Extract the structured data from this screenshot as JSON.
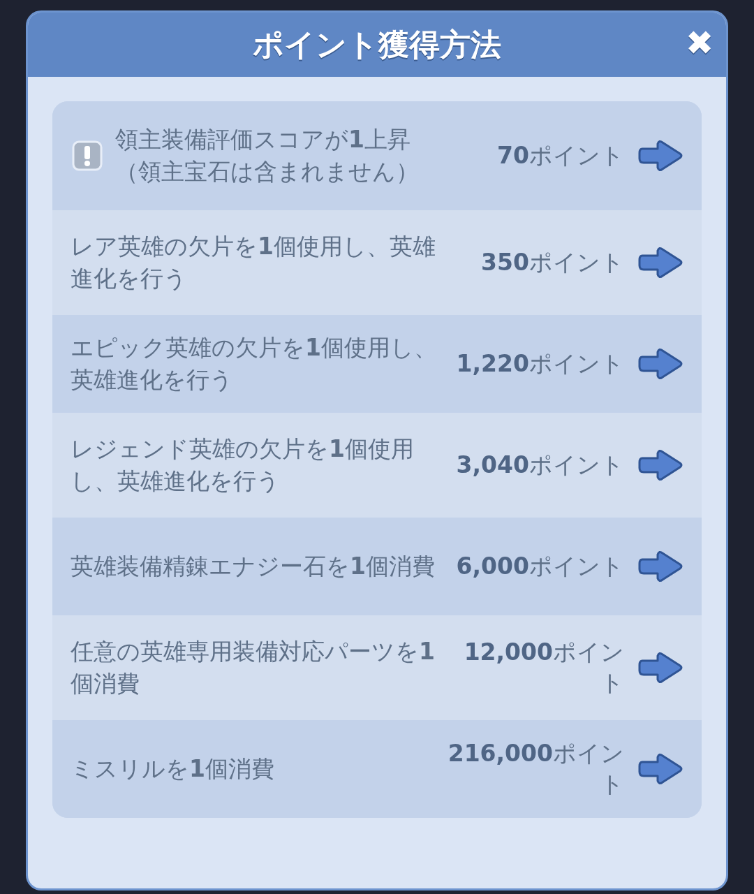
{
  "dialog": {
    "title": "ポイント獲得方法",
    "close_label": "✖"
  },
  "rows": [
    {
      "notice": true,
      "description": "領主装備評価スコアが**1**上昇（領主宝石は含まれません）",
      "points": "**70**ポイント"
    },
    {
      "notice": false,
      "description": "レア英雄の欠片を**1**個使用し、英雄進化を行う",
      "points": "**350**ポイント"
    },
    {
      "notice": false,
      "description": "エピック英雄の欠片を**1**個使用し、英雄進化を行う",
      "points": "**1,220**ポイント"
    },
    {
      "notice": false,
      "description": "レジェンド英雄の欠片を**1**個使用し、英雄進化を行う",
      "points": "**3,040**ポイント"
    },
    {
      "notice": false,
      "description": "英雄装備精錬エナジー石を**1**個消費",
      "points": "**6,000**ポイント"
    },
    {
      "notice": false,
      "description": "任意の英雄専用装備対応パーツを**1**個消費",
      "points": "**12,000**ポイント"
    },
    {
      "notice": false,
      "description": "ミスリルを**1**個消費",
      "points": "**216,000**ポイント"
    }
  ]
}
